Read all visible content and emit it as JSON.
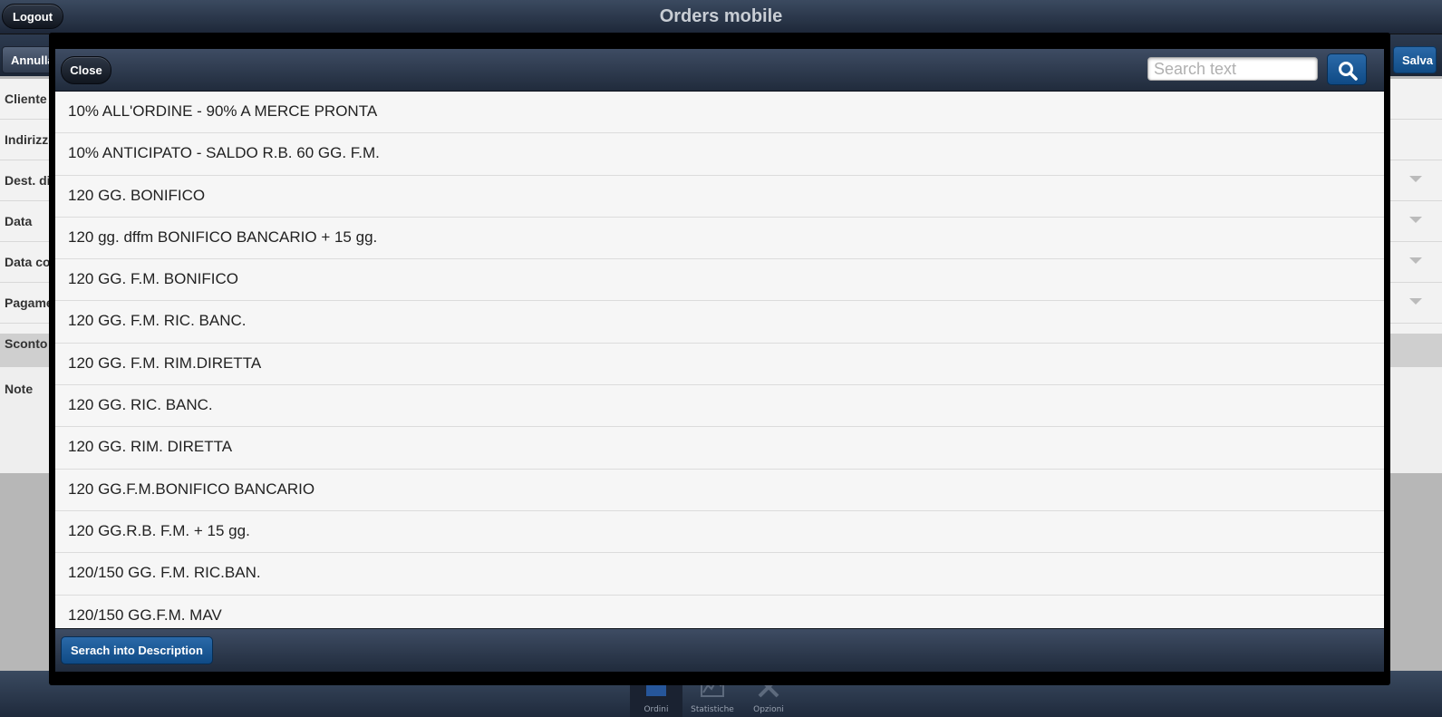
{
  "app": {
    "title": "Orders mobile"
  },
  "topbar": {
    "logout_label": "Logout"
  },
  "toolbar": {
    "cancel_label": "Annulla",
    "save_label": "Salva"
  },
  "form": {
    "rows": [
      {
        "label": "Cliente",
        "dropdown": false
      },
      {
        "label": "Indirizzo",
        "dropdown": false
      },
      {
        "label": "Dest. diversa",
        "dropdown": true
      },
      {
        "label": "Data",
        "dropdown": true
      },
      {
        "label": "Data consegna",
        "dropdown": true
      },
      {
        "label": "Pagamento",
        "dropdown": true
      },
      {
        "label": "Sconto",
        "dropdown": false
      },
      {
        "label": "Note",
        "dropdown": false
      }
    ]
  },
  "bottom_nav": {
    "items": [
      {
        "label": "Ordini",
        "icon": "cart-icon",
        "active": true
      },
      {
        "label": "Statistiche",
        "icon": "chart-icon",
        "active": false
      },
      {
        "label": "Opzioni",
        "icon": "tools-icon",
        "active": false
      }
    ]
  },
  "modal": {
    "close_label": "Close",
    "search": {
      "placeholder": "Search text",
      "value": ""
    },
    "search_button_icon": "search-icon",
    "footer_button_label": "Serach into Description",
    "items": [
      "10% ALL'ORDINE - 90% A MERCE PRONTA",
      "10% ANTICIPATO - SALDO R.B. 60 GG. F.M.",
      "120 GG. BONIFICO",
      "120 gg. dffm BONIFICO BANCARIO + 15 gg.",
      "120 GG. F.M. BONIFICO",
      "120 GG. F.M. RIC. BANC.",
      "120 GG. F.M. RIM.DIRETTA",
      "120 GG. RIC. BANC.",
      "120 GG. RIM. DIRETTA",
      "120 GG.F.M.BONIFICO BANCARIO",
      "120 GG.R.B. F.M. + 15 gg.",
      "120/150 GG. F.M. RIC.BAN.",
      "120/150 GG.F.M. MAV"
    ]
  }
}
